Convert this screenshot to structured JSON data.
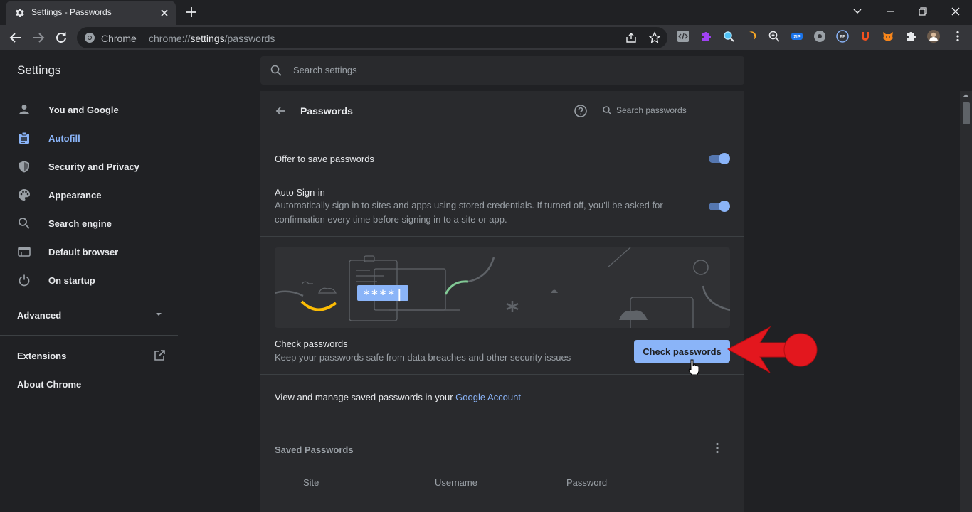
{
  "tab": {
    "title": "Settings - Passwords",
    "icon": "gear-icon"
  },
  "omnibox": {
    "site_label": "Chrome",
    "url_prefix": "chrome://",
    "url_host": "settings",
    "url_path": "/passwords"
  },
  "extensions": [
    "code-extension-icon",
    "puzzle-purple-extension-icon",
    "magnifier-extension-icon",
    "orange-moon-extension-icon",
    "zoom-extension-icon",
    "zip-extension-icon",
    "circle-extension-icon",
    "ef-extension-icon",
    "u-extension-icon",
    "fox-extension-icon",
    "extensions-puzzle-icon",
    "profile-avatar"
  ],
  "header": {
    "title": "Settings",
    "search_placeholder": "Search settings"
  },
  "sidebar": {
    "items": [
      {
        "label": "You and Google",
        "icon": "person-icon"
      },
      {
        "label": "Autofill",
        "icon": "clipboard-icon",
        "active": true
      },
      {
        "label": "Security and Privacy",
        "icon": "shield-icon"
      },
      {
        "label": "Appearance",
        "icon": "palette-icon"
      },
      {
        "label": "Search engine",
        "icon": "search-icon"
      },
      {
        "label": "Default browser",
        "icon": "browser-window-icon"
      },
      {
        "label": "On startup",
        "icon": "power-icon"
      }
    ],
    "advanced": "Advanced",
    "extensions": "Extensions",
    "about": "About Chrome"
  },
  "passwords": {
    "title": "Passwords",
    "search_placeholder": "Search passwords",
    "offer_to_save": "Offer to save passwords",
    "auto_signin_title": "Auto Sign-in",
    "auto_signin_desc": "Automatically sign in to sites and apps using stored credentials. If turned off, you'll be asked for confirmation every time before signing in to a site or app.",
    "banner_password": "****|",
    "check_title": "Check passwords",
    "check_desc": "Keep your passwords safe from data breaches and other security issues",
    "check_button": "Check passwords",
    "manage_text": "View and manage saved passwords in your",
    "manage_link": "Google Account",
    "saved_title": "Saved Passwords",
    "columns": [
      "Site",
      "Username",
      "Password"
    ]
  },
  "colors": {
    "accent": "#8ab4f8",
    "background": "#202124",
    "surface": "#292a2d",
    "annotation": "#e3171e"
  }
}
